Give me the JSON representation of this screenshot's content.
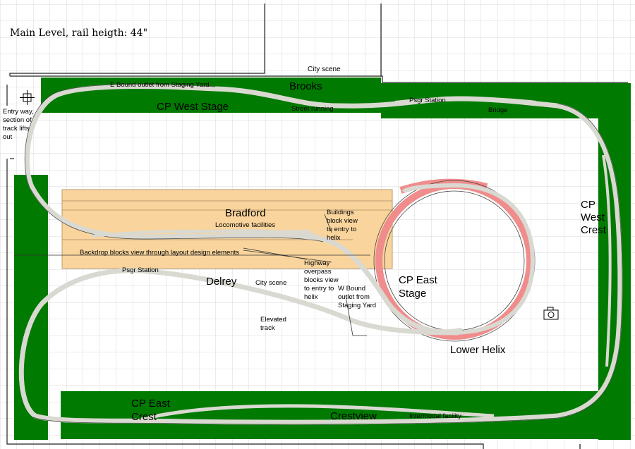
{
  "title": "Main Level, rail heigth: 44\"",
  "colors": {
    "benchwork": "#007a00",
    "yard_panel": "#f9d49c",
    "helix": "#f08c8c",
    "track": "#d9d9d2",
    "grid": "#d8d8d8"
  },
  "labels": {
    "city_scene_top": "City scene",
    "e_bound_outlet": "E Bound outlet from Staging Yard",
    "brooks": "Brooks",
    "psgr_station_top": "Psgr Station",
    "cp_west_stage": "CP West Stage",
    "street_running": "Street running",
    "bridge": "Bridge",
    "entry_way": [
      "Entry way,",
      "section of",
      "track lifts",
      "out"
    ],
    "cp_west_crest": [
      "CP",
      "West",
      "Crest"
    ],
    "bradford": "Bradford",
    "locomotive_facilities": "Locomotive facilities",
    "buildings_block": [
      "Buildings",
      "block view",
      "to entry to",
      "helix"
    ],
    "backdrop_blocks": "Backdrop blocks view through layout design elements",
    "psgr_station_mid": "Psgr Station",
    "highway_overpass": [
      "Highway",
      "overpass",
      "blocks view",
      "to entry to",
      "helix"
    ],
    "delrey": "Delrey",
    "city_scene_mid": "City scene",
    "w_bound_outlet": [
      "W Bound",
      "outlet from",
      "Staging Yard"
    ],
    "cp_east_stage": [
      "CP East",
      "Stage"
    ],
    "elevated_track": [
      "Elevated",
      "track"
    ],
    "lower_helix": "Lower Helix",
    "cp_east_crest": [
      "CP East",
      "Crest"
    ],
    "crestview": "Crestview",
    "intermodal_facility": "Intermodal facility"
  },
  "icons": {
    "entry_marker": "crosshair-icon",
    "camera": "camera-icon"
  }
}
